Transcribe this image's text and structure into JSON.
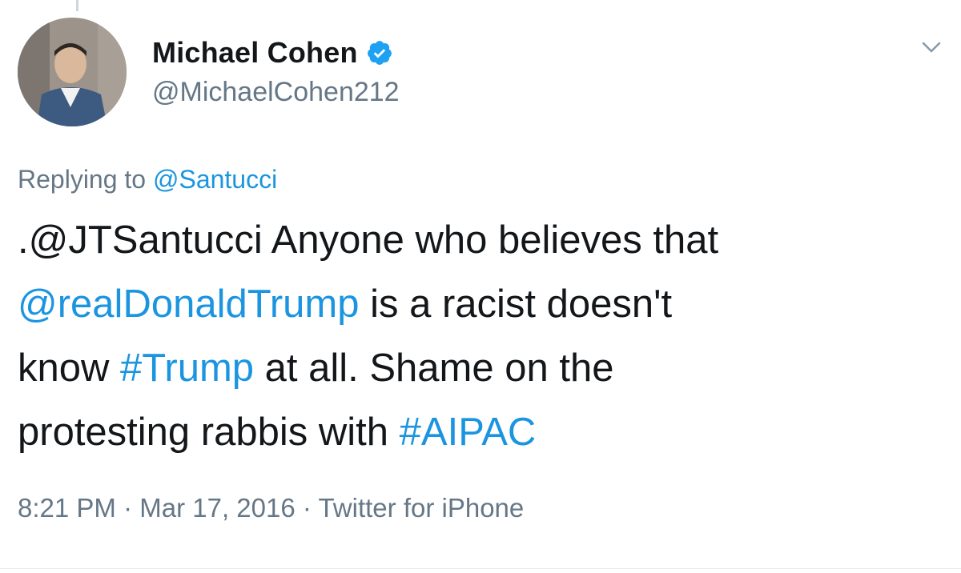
{
  "tweet": {
    "author": {
      "display_name": "Michael Cohen",
      "handle": "@MichaelCohen212",
      "verified_icon": "verified-badge-icon"
    },
    "reply_label": "Replying to",
    "reply_to": "@Santucci",
    "text": {
      "part1": ".@JTSantucci",
      "part2": " Anyone who believes that",
      "mention": "@realDonaldTrump",
      "part3": " is a racist doesn't",
      "part4": "know ",
      "hashtag1": "#Trump",
      "part5": " at all. Shame on the",
      "part6": "protesting rabbis with ",
      "hashtag2": "#AIPAC"
    },
    "time": "8:21 PM",
    "separator": "·",
    "date": "Mar 17, 2016",
    "source": "Twitter for iPhone"
  },
  "colors": {
    "link": "#1b95e0",
    "secondary_text": "#657786",
    "primary_text": "#14171a"
  },
  "icons": {
    "menu": "chevron-down-icon"
  }
}
